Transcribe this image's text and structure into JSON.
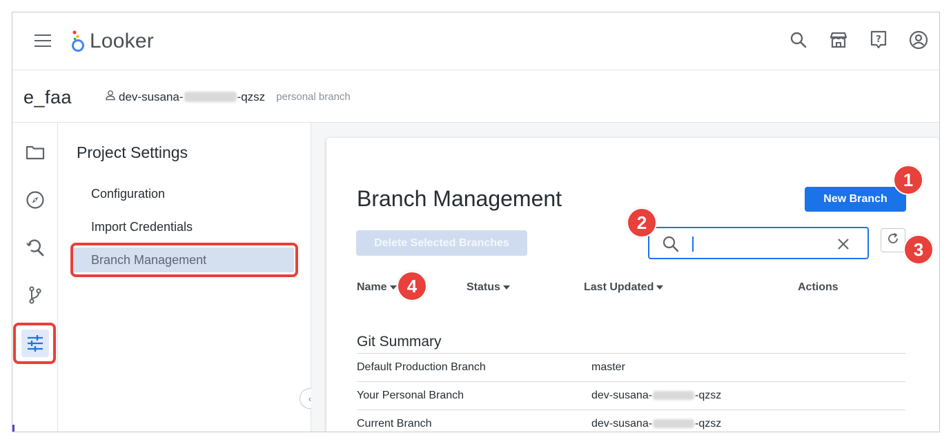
{
  "app": {
    "name": "Looker"
  },
  "header": {
    "icons": [
      "search-icon",
      "marketplace-icon",
      "help-icon",
      "account-icon"
    ]
  },
  "project": {
    "name": "e_faa",
    "branch_prefix": "dev-susana-",
    "branch_suffix": "-qzsz",
    "branch_kind": "personal branch"
  },
  "rail": {
    "items": [
      "folder-icon",
      "explore-compass-icon",
      "sql-search-icon",
      "git-branch-icon",
      "settings-sliders-icon"
    ],
    "active": "settings-sliders-icon"
  },
  "settings": {
    "title": "Project Settings",
    "items": [
      {
        "label": "Configuration"
      },
      {
        "label": "Import Credentials"
      },
      {
        "label": "Branch Management",
        "active": true
      }
    ]
  },
  "branch_management": {
    "title": "Branch Management",
    "new_branch_label": "New Branch",
    "delete_label": "Delete Selected Branches",
    "search_value": "",
    "columns": [
      {
        "label": "Name",
        "sortable": true
      },
      {
        "label": "Status",
        "sortable": true
      },
      {
        "label": "Last Updated",
        "sortable": true
      },
      {
        "label": "Actions",
        "sortable": false
      }
    ],
    "git_summary": {
      "title": "Git Summary",
      "rows": [
        {
          "label": "Default Production Branch",
          "value": "master"
        },
        {
          "label": "Your Personal Branch",
          "value_prefix": "dev-susana-",
          "value_suffix": "-qzsz"
        },
        {
          "label": "Current Branch",
          "value_prefix": "dev-susana-",
          "value_suffix": "-qzsz"
        }
      ]
    }
  },
  "callouts": [
    "1",
    "2",
    "3",
    "4"
  ],
  "colors": {
    "primary": "#1a73e8",
    "highlight_red": "#e8403a",
    "active_nav_bg": "#d4dff0",
    "disabled_button_bg": "#cfdcf0"
  }
}
